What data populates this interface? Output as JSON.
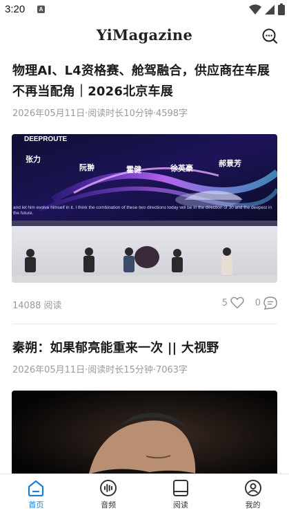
{
  "status_bar": {
    "time": "3:20",
    "notification_icon": "A"
  },
  "app_bar": {
    "title": "YiMagazine"
  },
  "articles": [
    {
      "headline": "物理AI、L4资格赛、舱驾融合，供应商在车展不再当配角｜2026北京车展",
      "meta": "2026年05月11日·阅读时长10分钟·4598字",
      "image": {
        "brand": "DEEPROUTE",
        "names": [
          "张力",
          "阮翀",
          "霍健",
          "徐英豪",
          "郝景芳"
        ],
        "caption": "and let him evolve himself in it. I think the combination of these two directions today will be in the direction of 30 and the deepest in the future."
      },
      "reads": "14088",
      "reads_label": "阅读",
      "likes": "5",
      "comments": "0"
    },
    {
      "headline": "秦朔：如果郁亮能重来一次 || 大视野",
      "meta": "2026年05月11日·阅读时长15分钟·7063字"
    }
  ],
  "tabs": [
    {
      "label": "首页",
      "icon": "home-icon",
      "active": true
    },
    {
      "label": "音频",
      "icon": "audio-icon",
      "active": false
    },
    {
      "label": "阅读",
      "icon": "tablet-icon",
      "active": false
    },
    {
      "label": "我的",
      "icon": "user-icon",
      "active": false
    }
  ],
  "colors": {
    "accent": "#1a7fd6",
    "meta_gray": "#9a9a9a"
  }
}
